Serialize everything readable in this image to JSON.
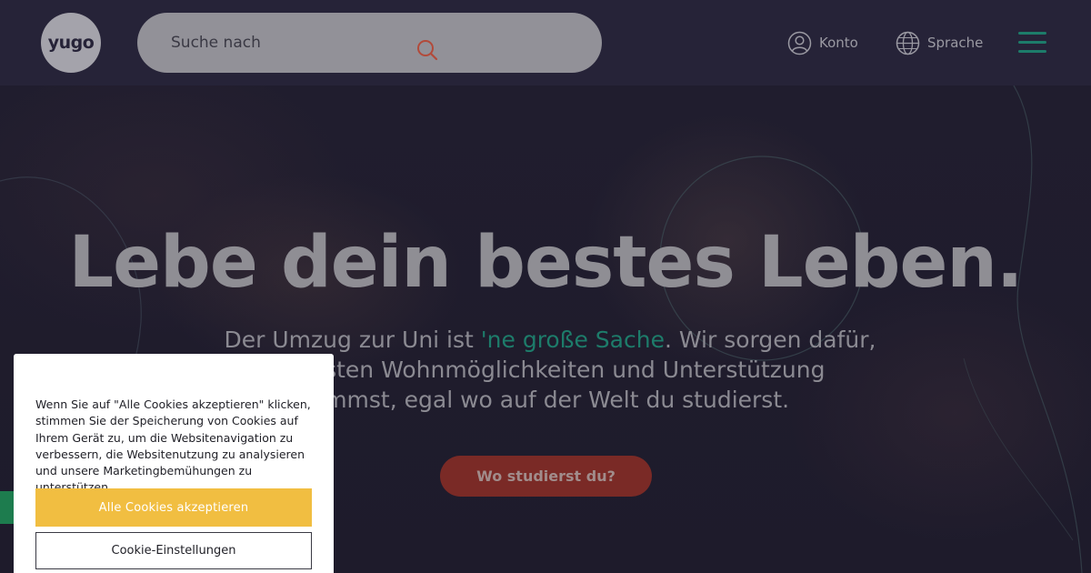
{
  "header": {
    "logo_text": "yugo",
    "search": {
      "placeholder": "Suche nach"
    },
    "nav": {
      "account_label": "Konto",
      "language_label": "Sprache"
    }
  },
  "hero": {
    "title": "Lebe dein bestes Leben.",
    "subtitle_part1": "Der Umzug zur Uni ist ",
    "subtitle_accent": "'ne große Sache",
    "subtitle_part2": ". Wir sorgen dafür,",
    "subtitle_line2": "e besten Wohnmöglichkeiten und Unterstützung",
    "subtitle_line3": "ommst, egal wo auf der Welt du studierst.",
    "cta_label": "Wo studierst du?"
  },
  "cookie_banner": {
    "text": "Wenn Sie auf \"Alle Cookies akzeptieren\" klicken, stimmen Sie der Speicherung von Cookies auf Ihrem Gerät zu, um die Websitenavigation zu verbessern, die Websitenutzung zu analysieren und unsere Marketingbemühungen zu unterstützen.",
    "accept_label": "Alle Cookies akzeptieren",
    "settings_label": "Cookie-Einstellungen"
  },
  "colors": {
    "header_bg": "#262338",
    "accent_teal": "#1d7c6a",
    "cta_red": "#7a2a26",
    "cookie_accept_yellow": "#f1be41",
    "search_icon": "#b24a3a"
  },
  "icons": {
    "search": "search-icon",
    "account": "user-circle-icon",
    "language": "globe-icon",
    "menu": "hamburger-menu-icon"
  }
}
